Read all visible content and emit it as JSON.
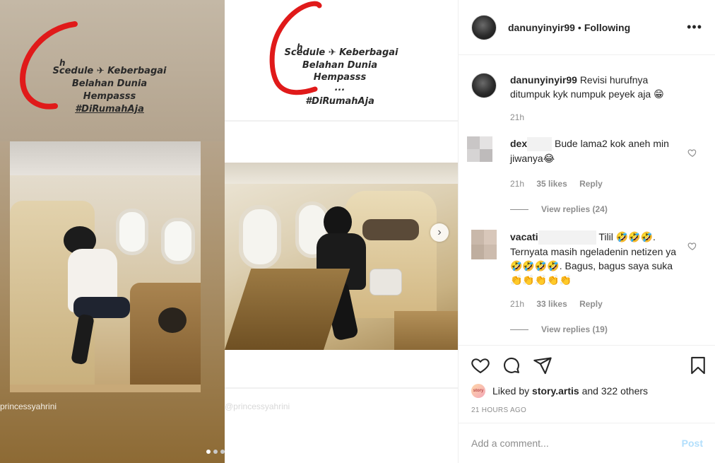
{
  "media": {
    "story_left": {
      "line1": "Scedule ✈ Keberbagai",
      "line2": "Belahan Dunia",
      "line3": "Hempasss",
      "hashtag": "#DiRumahAja",
      "h_letter": "h"
    },
    "story_right": {
      "line1": "Scedule ✈ Keberbagai",
      "line2": "Belahan Dunia",
      "line3": "Hempasss",
      "ellipsis": "...",
      "hashtag": "#DiRumahAja",
      "h_letter": "h"
    },
    "watermark_left": "princessyahrini",
    "watermark_right": "@princessyahrini",
    "carousel_dots": 3,
    "active_dot": 0,
    "next_icon": "chevron-right-icon"
  },
  "post": {
    "username": "danunyinyir99",
    "separator": "•",
    "follow_status": "Following",
    "more_icon": "•••",
    "caption": {
      "username": "danunyinyir99",
      "text": "Revisi hurufnya ditumpuk kyk numpuk peyek aja 😁",
      "time": "21h"
    },
    "comments": [
      {
        "username": "dex",
        "text": "Bude lama2 kok aneh min jiwanya😂",
        "time": "21h",
        "likes": "35 likes",
        "reply_label": "Reply",
        "view_replies": "View replies (24)"
      },
      {
        "username": "vacati",
        "text": "Tilil 🤣🤣🤣. Ternyata masih ngeladenin netizen ya 🤣🤣🤣🤣. Bagus, bagus saya suka 👏👏👏👏👏",
        "time": "21h",
        "likes": "33 likes",
        "reply_label": "Reply",
        "view_replies": "View replies (19)"
      }
    ],
    "liked_by_prefix": "Liked by",
    "liked_by_user": "story.artis",
    "liked_by_suffix": "and 322 others",
    "liker_avatar_text": "story",
    "timestamp": "21 HOURS AGO",
    "add_comment_placeholder": "Add a comment...",
    "post_button": "Post"
  },
  "colors": {
    "accent_disabled": "#b2dffc",
    "text_primary": "#262626",
    "text_secondary": "#8e8e8e",
    "border": "#efefef",
    "story_red": "#e01a1a"
  }
}
